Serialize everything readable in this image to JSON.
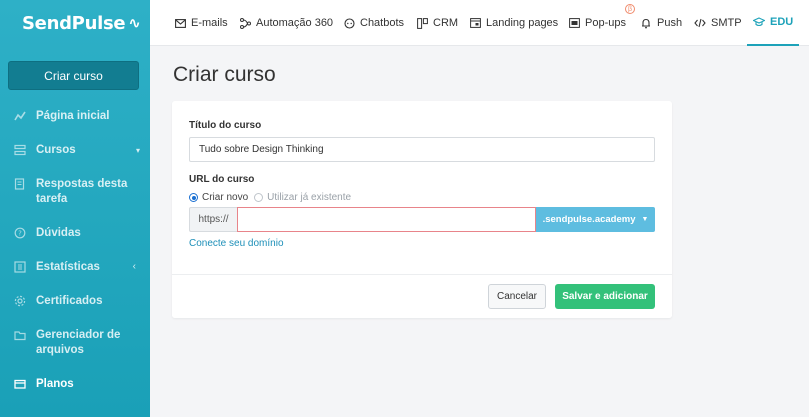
{
  "brand": {
    "name": "SendPulse",
    "pulse_glyph": "∿"
  },
  "sidebar": {
    "create_button": "Criar curso",
    "items": [
      {
        "label": "Página inicial",
        "icon": "chart-line-icon"
      },
      {
        "label": "Cursos",
        "icon": "layers-icon",
        "arrow": "▾"
      },
      {
        "label": "Respostas desta tarefa",
        "icon": "document-edit-icon"
      },
      {
        "label": "Dúvidas",
        "icon": "question-bubble-icon"
      },
      {
        "label": "Estatísticas",
        "icon": "stats-grid-icon",
        "arrow": "‹"
      },
      {
        "label": "Certificados",
        "icon": "gear-icon"
      },
      {
        "label": "Gerenciador de arquivos",
        "icon": "folder-icon"
      },
      {
        "label": "Planos",
        "icon": "wallet-icon"
      }
    ]
  },
  "topnav": {
    "items": [
      {
        "label": "E-mails",
        "icon": "mail-icon"
      },
      {
        "label": "Automação 360",
        "icon": "automation-icon"
      },
      {
        "label": "Chatbots",
        "icon": "chat-icon"
      },
      {
        "label": "CRM",
        "icon": "crm-icon"
      },
      {
        "label": "Landing pages",
        "icon": "landing-icon"
      },
      {
        "label": "Pop-ups",
        "icon": "popup-icon",
        "badge": "β"
      },
      {
        "label": "Push",
        "icon": "bell-icon"
      },
      {
        "label": "SMTP",
        "icon": "code-icon"
      },
      {
        "label": "EDU",
        "icon": "graduation-cap-icon",
        "active": true
      }
    ]
  },
  "main": {
    "title": "Criar curso",
    "form": {
      "course_title_label": "Título do curso",
      "course_title_value": "Tudo sobre Design Thinking",
      "url_label": "URL do curso",
      "radio_new": "Criar novo",
      "radio_existing": "Utilizar já existente",
      "url_prefix": "https://",
      "url_value": "",
      "domain_suffix": ".sendpulse.academy",
      "connect_domain_link": "Conecte seu domínio"
    },
    "buttons": {
      "cancel": "Cancelar",
      "save": "Salvar e adicionar"
    }
  },
  "colors": {
    "sidebar": "#1aa0b7",
    "accent": "#1da2b9",
    "save": "#33c17a",
    "domain_button": "#5ebde0"
  }
}
